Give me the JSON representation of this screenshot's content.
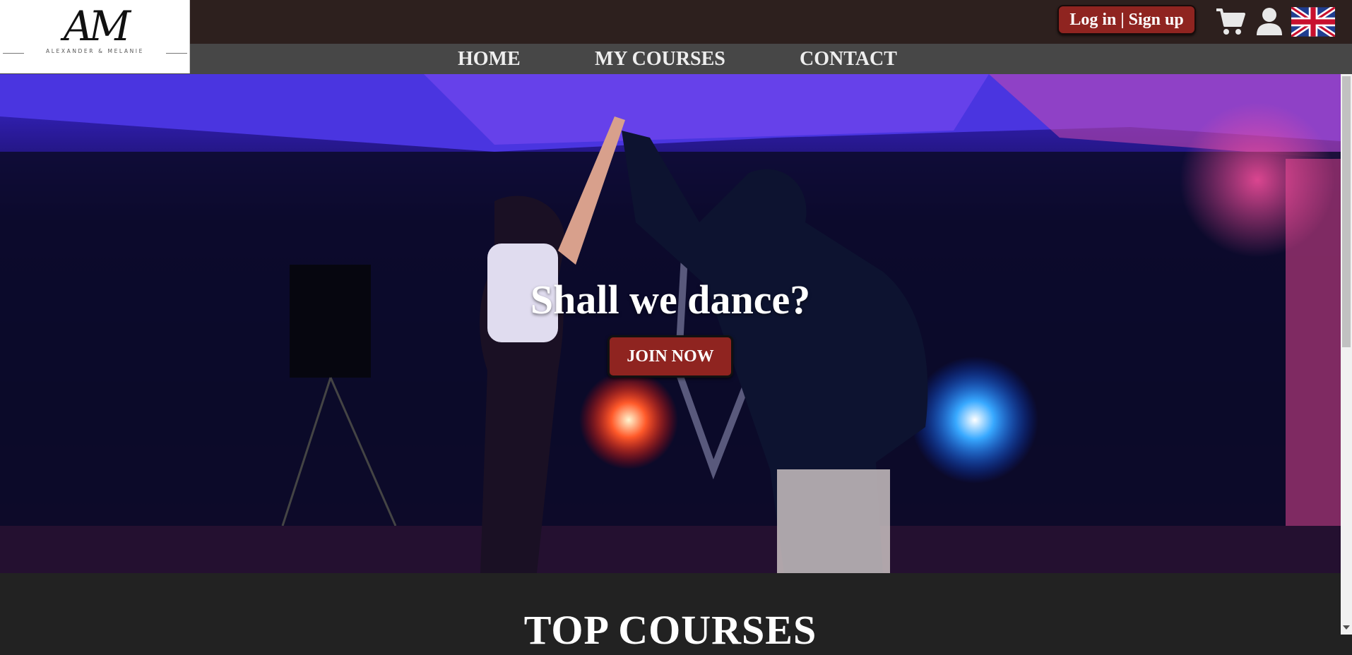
{
  "logo": {
    "mark": "AM",
    "subtitle": "ALEXANDER & MELANIE"
  },
  "header": {
    "login_label": "Log in | Sign up",
    "icons": [
      "cart-icon",
      "user-icon",
      "uk-flag-icon"
    ]
  },
  "nav": {
    "items": [
      {
        "label": "HOME"
      },
      {
        "label": "MY COURSES"
      },
      {
        "label": "CONTACT"
      }
    ]
  },
  "hero": {
    "title": "Shall we dance?",
    "cta_label": "JOIN NOW"
  },
  "sections": {
    "top_courses_title": "TOP COURSES"
  },
  "colors": {
    "topbar": "#2d201e",
    "navbar": "#474747",
    "accent": "#8f2420",
    "page_bg": "#222222"
  }
}
